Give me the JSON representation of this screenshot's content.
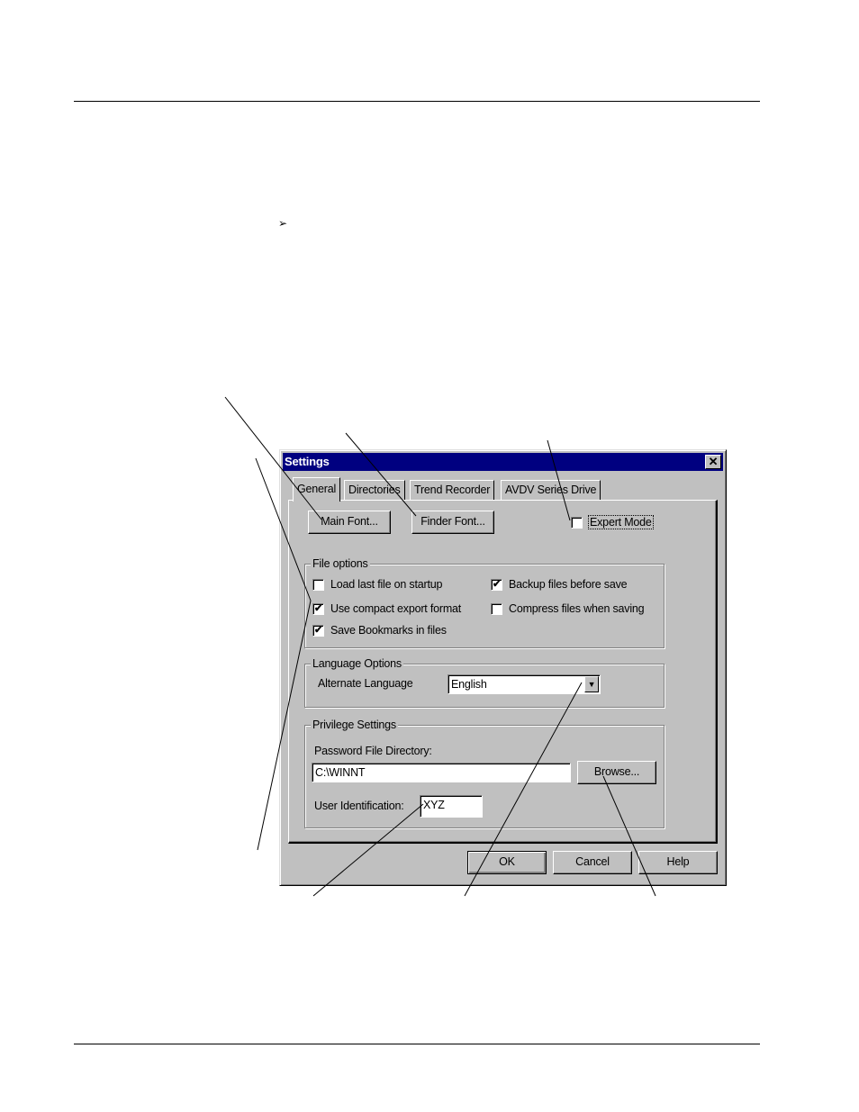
{
  "page": {
    "bullet_glyph": "➢"
  },
  "dialog": {
    "title": "Settings",
    "close_glyph": "✕",
    "tabs": [
      {
        "label": "General",
        "active": true
      },
      {
        "label": "Directories",
        "active": false
      },
      {
        "label": "Trend Recorder",
        "active": false
      },
      {
        "label": "AVDV Series Drive",
        "active": false
      }
    ],
    "buttons": {
      "main_font": "Main Font...",
      "finder_font": "Finder Font...",
      "browse": "Browse...",
      "ok": "OK",
      "cancel": "Cancel",
      "help": "Help"
    },
    "expert_mode": {
      "label": "Expert Mode",
      "checked": false
    },
    "file_options": {
      "title": "File options",
      "items": [
        {
          "label": "Load last file on startup",
          "checked": false
        },
        {
          "label": "Backup files before save",
          "checked": true
        },
        {
          "label": "Use compact export format",
          "checked": true
        },
        {
          "label": "Compress files when saving",
          "checked": false
        },
        {
          "label": "Save Bookmarks in files",
          "checked": true
        }
      ]
    },
    "language_options": {
      "title": "Language Options",
      "alternate_label": "Alternate Language",
      "selected": "English"
    },
    "privilege_settings": {
      "title": "Privilege Settings",
      "password_dir_label": "Password File Directory:",
      "password_dir_value": "C:\\WINNT",
      "user_id_label": "User Identification:",
      "user_id_value": "XYZ"
    },
    "check_glyph": "✔",
    "dropdown_glyph": "▼"
  }
}
